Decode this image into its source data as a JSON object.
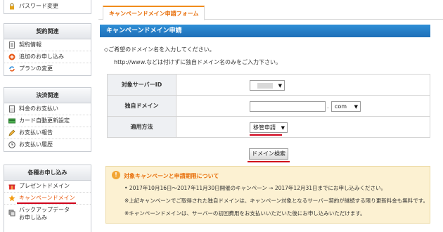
{
  "sidebar": {
    "top_items": [
      {
        "label": "パスワード変更",
        "icon": "lock-icon"
      }
    ],
    "contract": {
      "title": "契約関連",
      "items": [
        {
          "label": "契約情報",
          "icon": "document-icon"
        },
        {
          "label": "追加のお申し込み",
          "icon": "add-icon"
        },
        {
          "label": "プランの変更",
          "icon": "refresh-icon"
        }
      ]
    },
    "payment": {
      "title": "決済関連",
      "items": [
        {
          "label": "料金のお支払い",
          "icon": "calculator-icon"
        },
        {
          "label": "カード自動更新設定",
          "icon": "card-icon"
        },
        {
          "label": "お支払い報告",
          "icon": "pencil-icon"
        },
        {
          "label": "お支払い履歴",
          "icon": "clock-icon"
        }
      ]
    },
    "apply": {
      "title": "各種お申し込み",
      "items": [
        {
          "label": "プレゼントドメイン",
          "icon": "gift-icon"
        },
        {
          "label": "キャンペーンドメイン",
          "icon": "star-icon"
        },
        {
          "label": "バックアップデータ",
          "label2": "お申し込み",
          "icon": "backup-icon"
        }
      ]
    }
  },
  "tab": {
    "label": "キャンペーンドメイン申請フォーム"
  },
  "panel": {
    "title": "キャンペーンドメイン申請",
    "desc1": "◇ご希望のドメイン名を入力してください。",
    "desc2": "http://www.などは付けずに独自ドメイン名のみをご入力下さい。"
  },
  "form": {
    "server_label": "対象サーバーID",
    "server_value": "",
    "domain_label": "独自ドメイン",
    "domain_value": "",
    "domain_placeholder": "",
    "dot": ".",
    "tld_value": "com",
    "method_label": "適用方法",
    "method_value": "移管申請"
  },
  "search_button": "ドメイン検索",
  "notice": {
    "icon": "!",
    "title": "対象キャンペーンと申請期限について",
    "bullet": "• 2017年10月16日〜2017年11月30日開催のキャンペーン → 2017年12月31日までにお申し込みください。",
    "note1": "※上記キャンペーンでご取得された独自ドメインは、キャンペーン対象となるサーバー契約が継続する限り更新料金も無料です。",
    "note2": "※キャンペーンドメインは、サーバーの初回費用をお支払いいただいた後にお申し込みいただけます。"
  },
  "colors": {
    "accent": "#e8700c",
    "header_blue": "#1f6fb8",
    "highlight_red": "#d0021b",
    "notice_bg": "#fcf1d2"
  }
}
